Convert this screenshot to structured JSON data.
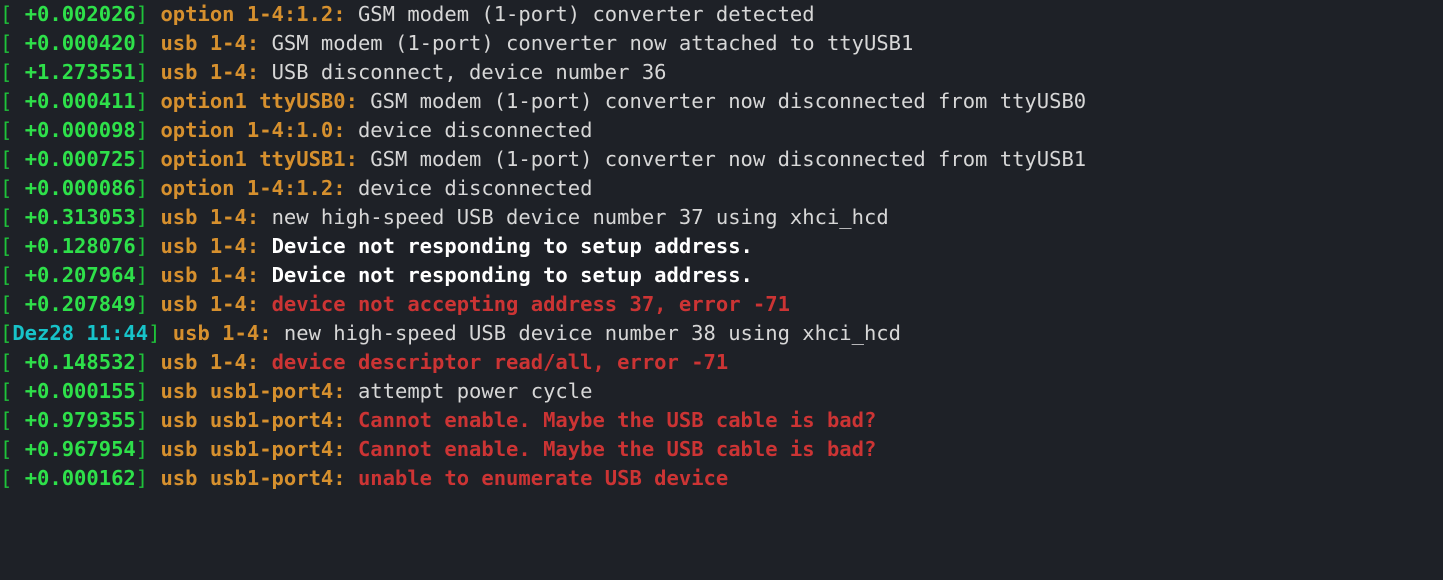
{
  "lines": [
    {
      "br_open": "[ ",
      "time": "+0.002026",
      "time_cls": "ts",
      "br_close": "] ",
      "src": "option 1-4:1.2: ",
      "msg": "GSM modem (1-port) converter detected",
      "msg_cls": "msg"
    },
    {
      "br_open": "[ ",
      "time": "+0.000420",
      "time_cls": "ts",
      "br_close": "] ",
      "src": "usb 1-4: ",
      "msg": "GSM modem (1-port) converter now attached to ttyUSB1",
      "msg_cls": "msg"
    },
    {
      "br_open": "[ ",
      "time": "+1.273551",
      "time_cls": "ts",
      "br_close": "] ",
      "src": "usb 1-4: ",
      "msg": "USB disconnect, device number 36",
      "msg_cls": "msg"
    },
    {
      "br_open": "[ ",
      "time": "+0.000411",
      "time_cls": "ts",
      "br_close": "] ",
      "src": "option1 ttyUSB0: ",
      "msg": "GSM modem (1-port) converter now disconnected from ttyUSB0",
      "msg_cls": "msg"
    },
    {
      "br_open": "[ ",
      "time": "+0.000098",
      "time_cls": "ts",
      "br_close": "] ",
      "src": "option 1-4:1.0: ",
      "msg": "device disconnected",
      "msg_cls": "msg"
    },
    {
      "br_open": "[ ",
      "time": "+0.000725",
      "time_cls": "ts",
      "br_close": "] ",
      "src": "option1 ttyUSB1: ",
      "msg": "GSM modem (1-port) converter now disconnected from ttyUSB1",
      "msg_cls": "msg"
    },
    {
      "br_open": "[ ",
      "time": "+0.000086",
      "time_cls": "ts",
      "br_close": "] ",
      "src": "option 1-4:1.2: ",
      "msg": "device disconnected",
      "msg_cls": "msg"
    },
    {
      "br_open": "[ ",
      "time": "+0.313053",
      "time_cls": "ts",
      "br_close": "] ",
      "src": "usb 1-4: ",
      "msg": "new high-speed USB device number 37 using xhci_hcd",
      "msg_cls": "msg"
    },
    {
      "br_open": "[ ",
      "time": "+0.128076",
      "time_cls": "ts",
      "br_close": "] ",
      "src": "usb 1-4: ",
      "msg": "Device not responding to setup address.",
      "msg_cls": "msgb"
    },
    {
      "br_open": "[ ",
      "time": "+0.207964",
      "time_cls": "ts",
      "br_close": "] ",
      "src": "usb 1-4: ",
      "msg": "Device not responding to setup address.",
      "msg_cls": "msgb"
    },
    {
      "br_open": "[ ",
      "time": "+0.207849",
      "time_cls": "ts",
      "br_close": "] ",
      "src": "usb 1-4: ",
      "msg": "device not accepting address 37, error -71",
      "msg_cls": "err"
    },
    {
      "br_open": "[",
      "time": "Dez28 11:44",
      "time_cls": "dt",
      "br_close": "] ",
      "src": "usb 1-4: ",
      "msg": "new high-speed USB device number 38 using xhci_hcd",
      "msg_cls": "msg"
    },
    {
      "br_open": "[ ",
      "time": "+0.148532",
      "time_cls": "ts",
      "br_close": "] ",
      "src": "usb 1-4: ",
      "msg": "device descriptor read/all, error -71",
      "msg_cls": "err"
    },
    {
      "br_open": "[ ",
      "time": "+0.000155",
      "time_cls": "ts",
      "br_close": "] ",
      "src": "usb usb1-port4: ",
      "msg": "attempt power cycle",
      "msg_cls": "msg"
    },
    {
      "br_open": "[ ",
      "time": "+0.979355",
      "time_cls": "ts",
      "br_close": "] ",
      "src": "usb usb1-port4: ",
      "msg": "Cannot enable. Maybe the USB cable is bad?",
      "msg_cls": "err"
    },
    {
      "br_open": "[ ",
      "time": "+0.967954",
      "time_cls": "ts",
      "br_close": "] ",
      "src": "usb usb1-port4: ",
      "msg": "Cannot enable. Maybe the USB cable is bad?",
      "msg_cls": "err"
    },
    {
      "br_open": "[ ",
      "time": "+0.000162",
      "time_cls": "ts",
      "br_close": "] ",
      "src": "usb usb1-port4: ",
      "msg": "unable to enumerate USB device",
      "msg_cls": "err"
    }
  ]
}
